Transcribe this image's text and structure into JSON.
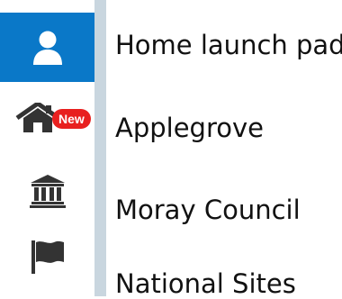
{
  "nav": {
    "items": [
      {
        "label": "Home launch pad",
        "icon": "user-icon",
        "active": true
      },
      {
        "label": "Applegrove",
        "icon": "home-icon",
        "badge": "New"
      },
      {
        "label": "Moray Council",
        "icon": "institution-icon"
      },
      {
        "label": "National Sites",
        "icon": "flag-icon"
      }
    ]
  },
  "colors": {
    "active_bg": "#0a78c8",
    "icon": "#333333",
    "badge_bg": "#e8201f",
    "strip": "#c9d6df"
  }
}
